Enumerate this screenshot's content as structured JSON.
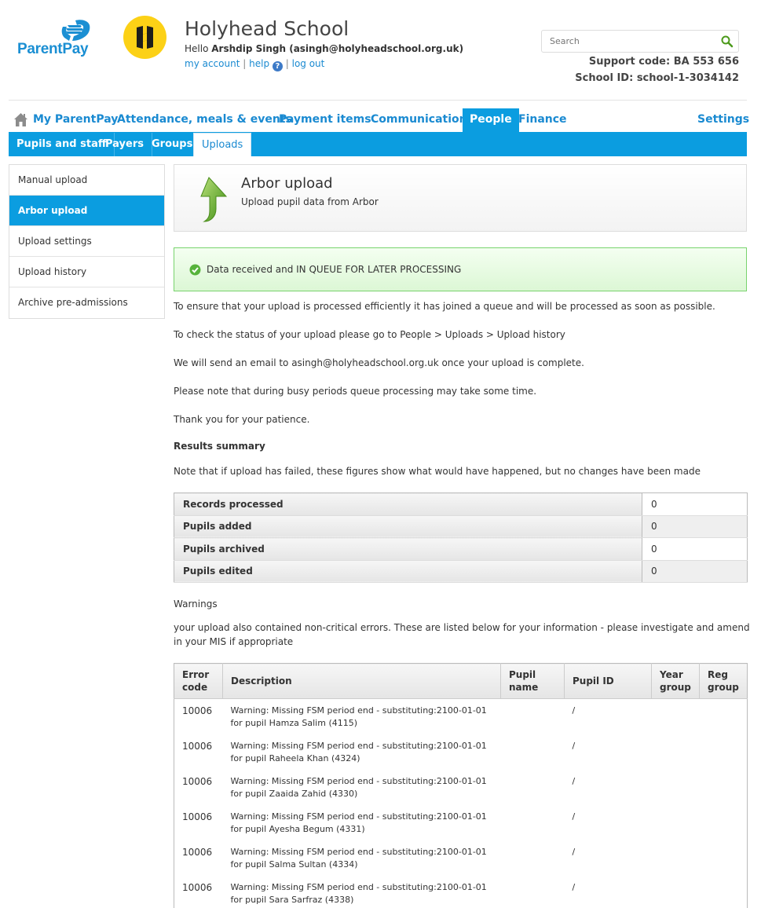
{
  "brand": {
    "logo_text": "ParentPay"
  },
  "school": {
    "name": "Holyhead School",
    "hello_prefix": "Hello ",
    "user": "Arshdip Singh (asingh@holyheadschool.org.uk)",
    "links": {
      "my_account": "my account",
      "help": "help",
      "help_icon": "?",
      "logout": "log out",
      "sep": "|"
    }
  },
  "search": {
    "placeholder": "Search"
  },
  "support": {
    "code": "Support code: BA 553 656",
    "school_id": "School ID: school-1-3034142"
  },
  "main_nav": {
    "my_parentpay": "My ParentPay",
    "attendance": "Attendance, meals & events",
    "payment_items": "Payment items",
    "communication": "Communication",
    "people": "People",
    "finance": "Finance",
    "settings": "Settings"
  },
  "sub_nav": {
    "pupils_staff": "Pupils and staff",
    "payers": "Payers",
    "groups": "Groups",
    "uploads": "Uploads"
  },
  "sidebar": {
    "items": [
      {
        "label": "Manual upload"
      },
      {
        "label": "Arbor upload"
      },
      {
        "label": "Upload settings"
      },
      {
        "label": "Upload history"
      },
      {
        "label": "Archive pre-admissions"
      }
    ]
  },
  "page": {
    "title": "Arbor upload",
    "subtitle": "Upload pupil data from Arbor",
    "success_msg": "Data received and IN QUEUE FOR LATER PROCESSING",
    "p1": "To ensure that your upload is processed efficiently it has joined a queue and will be processed as soon as possible.",
    "p2": "To check the status of your upload please go to People > Uploads > Upload history",
    "p3": "We will send an email to asingh@holyheadschool.org.uk once your upload is complete.",
    "p4": "Please note that during busy periods queue processing may take some time.",
    "p5": "Thank you for your patience.",
    "results_heading": "Results summary",
    "results_note": "Note that if upload has failed, these figures show what would have happened, but no changes have been made",
    "warnings_heading": "Warnings",
    "warnings_note": "your upload also contained non-critical errors. These are listed below for your information - please investigate and amend in your MIS if appropriate"
  },
  "results": [
    {
      "label": "Records processed",
      "value": "0"
    },
    {
      "label": "Pupils added",
      "value": "0"
    },
    {
      "label": "Pupils archived",
      "value": "0"
    },
    {
      "label": "Pupils edited",
      "value": "0"
    }
  ],
  "warnings_table": {
    "headers": {
      "code": "Error code",
      "description": "Description",
      "pupil_name": "Pupil name",
      "pupil_id": "Pupil ID",
      "year_group": "Year group",
      "reg_group": "Reg group"
    },
    "rows": [
      {
        "code": "10006",
        "desc1": "Warning: Missing FSM period end - substituting:2100-01-01",
        "desc2": "for pupil Hamza Salim (4115)",
        "pupil_name": "",
        "pupil_id": "/",
        "year": "",
        "reg": ""
      },
      {
        "code": "10006",
        "desc1": "Warning: Missing FSM period end - substituting:2100-01-01",
        "desc2": "for pupil Raheela Khan (4324)",
        "pupil_name": "",
        "pupil_id": "/",
        "year": "",
        "reg": ""
      },
      {
        "code": "10006",
        "desc1": "Warning: Missing FSM period end - substituting:2100-01-01",
        "desc2": "for pupil Zaaida Zahid (4330)",
        "pupil_name": "",
        "pupil_id": "/",
        "year": "",
        "reg": ""
      },
      {
        "code": "10006",
        "desc1": "Warning: Missing FSM period end - substituting:2100-01-01",
        "desc2": "for pupil Ayesha Begum (4331)",
        "pupil_name": "",
        "pupil_id": "/",
        "year": "",
        "reg": ""
      },
      {
        "code": "10006",
        "desc1": "Warning: Missing FSM period end - substituting:2100-01-01",
        "desc2": "for pupil Salma Sultan (4334)",
        "pupil_name": "",
        "pupil_id": "/",
        "year": "",
        "reg": ""
      },
      {
        "code": "10006",
        "desc1": "Warning: Missing FSM period end - substituting:2100-01-01",
        "desc2": "for pupil Sara Sarfraz (4338)",
        "pupil_name": "",
        "pupil_id": "/",
        "year": "",
        "reg": ""
      }
    ]
  }
}
